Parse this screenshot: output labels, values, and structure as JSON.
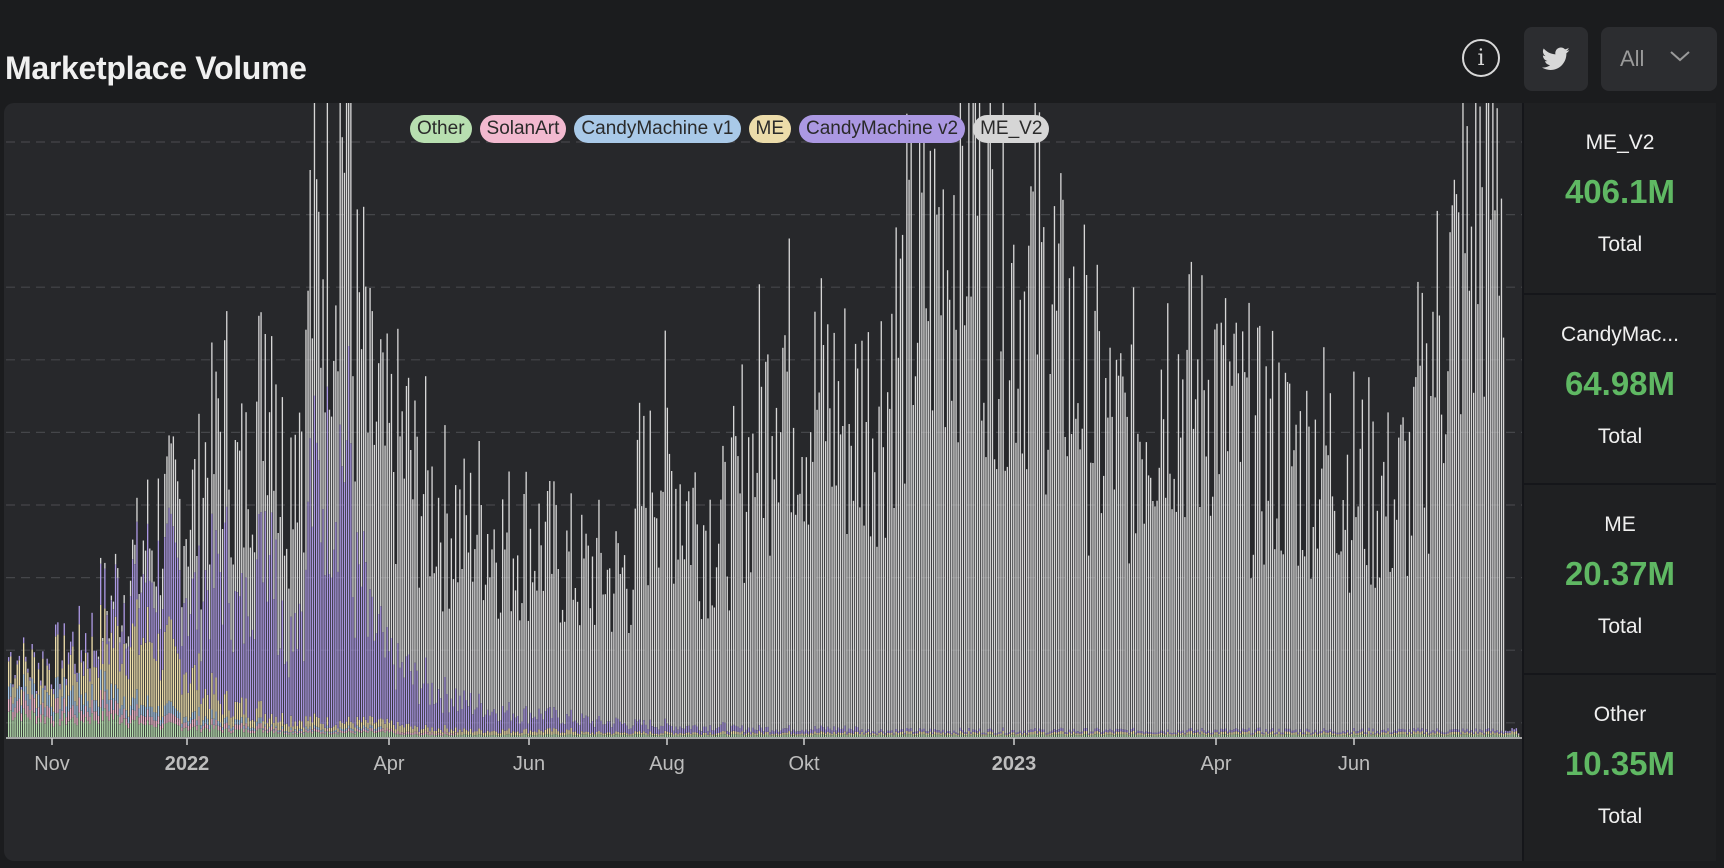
{
  "header": {
    "title": "Marketplace Volume",
    "info_icon": "info-circle-icon",
    "twitter_icon": "twitter-bird-icon",
    "filter_value": "All",
    "filter_icon": "chevron-down-icon"
  },
  "stats": [
    {
      "name": "ME_V2",
      "value": "406.1M",
      "caption": "Total"
    },
    {
      "name": "CandyMac...",
      "value": "64.98M",
      "caption": "Total"
    },
    {
      "name": "ME",
      "value": "20.37M",
      "caption": "Total"
    },
    {
      "name": "Other",
      "value": "10.35M",
      "caption": "Total"
    }
  ],
  "colors": {
    "value_green": "#5fb863",
    "panel_bg": "#27282b",
    "page_bg": "#1b1c1e"
  },
  "chart_data": {
    "type": "bar",
    "stacked": true,
    "title": "Marketplace Volume",
    "legend_position": "top-center",
    "grid": true,
    "legend": [
      {
        "name": "Other",
        "color": "#b8dfb0"
      },
      {
        "name": "SolanArt",
        "color": "#f2b9cf"
      },
      {
        "name": "CandyMachine v1",
        "color": "#a9c9e8"
      },
      {
        "name": "ME",
        "color": "#ecdcaa"
      },
      {
        "name": "CandyMachine v2",
        "color": "#ab98e2"
      },
      {
        "name": "ME_V2",
        "color": "#d6d6d6"
      }
    ],
    "x_ticks": [
      {
        "label": "Nov",
        "bold": false
      },
      {
        "label": "2022",
        "bold": true
      },
      {
        "label": "Apr",
        "bold": false
      },
      {
        "label": "Jun",
        "bold": false
      },
      {
        "label": "Aug",
        "bold": false
      },
      {
        "label": "Okt",
        "bold": false
      },
      {
        "label": "2023",
        "bold": true
      },
      {
        "label": "Apr",
        "bold": false
      },
      {
        "label": "Jun",
        "bold": false
      }
    ],
    "tick_positions": [
      48,
      183,
      385,
      525,
      663,
      800,
      1010,
      1212,
      1350
    ],
    "y_grid_count": 9,
    "weekly_envelope": [
      {
        "name": "Other",
        "values": [
          1.2,
          1.0,
          0.9,
          0.8,
          0.8,
          0.9,
          1.0,
          0.9,
          0.7,
          0.6,
          0.5,
          0.5,
          0.4,
          0.4,
          0.3,
          0.3,
          0.3,
          0.3,
          0.2,
          0.2,
          0.2,
          0.2,
          0.2,
          0.2,
          0.2,
          0.2,
          0.1,
          0.1,
          0.1,
          0.1,
          0.1,
          0.1,
          0.1,
          0.1,
          0.1,
          0.1,
          0.1,
          0.1,
          0.1,
          0.1,
          0.1,
          0.1,
          0.1,
          0.1,
          0.1,
          0.1,
          0.1,
          0.1,
          0.1,
          0.1,
          0.1,
          0.1,
          0.1,
          0.1,
          0.1,
          0.1,
          0.1,
          0.1,
          0.1,
          0.1,
          0.1,
          0.1,
          0.1,
          0.1,
          0.1,
          0.1,
          0.1,
          0.1,
          0.1,
          0.1,
          0.1,
          0.1,
          0.1,
          0.1,
          0.1,
          0.1,
          0.1,
          0.1,
          0.1,
          0.1,
          0.1,
          0.1,
          0.1,
          0.1,
          0.1,
          0.1,
          0.1,
          0.1,
          0.1,
          0.1,
          0.1,
          0.1,
          0.1,
          0.1,
          0.1,
          0.1,
          0.1,
          0.1,
          0.1,
          0.1,
          0.1
        ]
      },
      {
        "name": "SolanArt",
        "values": [
          0.6,
          0.6,
          0.5,
          0.5,
          0.5,
          0.5,
          0.6,
          0.5,
          0.4,
          0.4,
          0.3,
          0.3,
          0.3,
          0.2,
          0.2,
          0.2,
          0.2,
          0.2,
          0.1,
          0.1,
          0.1,
          0.1,
          0.1,
          0.1,
          0.1,
          0.1,
          0.1,
          0.1,
          0.1,
          0.1,
          0,
          0,
          0,
          0,
          0,
          0,
          0,
          0,
          0,
          0,
          0,
          0,
          0,
          0,
          0,
          0,
          0,
          0,
          0,
          0,
          0,
          0,
          0,
          0,
          0,
          0,
          0,
          0,
          0,
          0,
          0,
          0,
          0,
          0,
          0,
          0,
          0,
          0,
          0,
          0,
          0,
          0,
          0,
          0,
          0,
          0,
          0,
          0,
          0,
          0,
          0,
          0,
          0,
          0,
          0,
          0,
          0,
          0,
          0,
          0,
          0,
          0,
          0,
          0,
          0,
          0,
          0,
          0,
          0,
          0,
          0
        ]
      },
      {
        "name": "CandyMachine v1",
        "values": [
          0.6,
          0.6,
          0.6,
          0.7,
          0.8,
          0.6,
          0.7,
          0.6,
          0.5,
          0.5,
          0.4,
          0.3,
          0.3,
          0.3,
          0.2,
          0.2,
          0.2,
          0.1,
          0.1,
          0.1,
          0.1,
          0.1,
          0.1,
          0.1,
          0.1,
          0,
          0,
          0,
          0,
          0,
          0,
          0,
          0,
          0,
          0,
          0,
          0,
          0,
          0,
          0,
          0,
          0,
          0,
          0,
          0,
          0,
          0,
          0,
          0,
          0,
          0,
          0,
          0,
          0,
          0,
          0,
          0,
          0,
          0,
          0,
          0,
          0,
          0,
          0,
          0,
          0,
          0,
          0,
          0,
          0,
          0,
          0,
          0,
          0,
          0,
          0,
          0,
          0,
          0,
          0,
          0,
          0,
          0,
          0,
          0,
          0,
          0,
          0,
          0,
          0,
          0,
          0,
          0,
          0,
          0,
          0,
          0,
          0,
          0,
          0,
          0
        ]
      },
      {
        "name": "ME",
        "values": [
          1.2,
          1.1,
          1.2,
          1.4,
          1.6,
          1.8,
          2.2,
          2.6,
          3.0,
          3.2,
          2.8,
          2.4,
          1.8,
          1.2,
          0.9,
          0.7,
          0.6,
          0.5,
          0.5,
          0.4,
          0.4,
          0.3,
          0.3,
          0.3,
          0.3,
          0.3,
          0.3,
          0.2,
          0.2,
          0.2,
          0.2,
          0.2,
          0.2,
          0.2,
          0.2,
          0.2,
          0.2,
          0.2,
          0.1,
          0.1,
          0.1,
          0.1,
          0.1,
          0.1,
          0.1,
          0.1,
          0.1,
          0.1,
          0.1,
          0.1,
          0.1,
          0.1,
          0.1,
          0.1,
          0.1,
          0.1,
          0.1,
          0.1,
          0.1,
          0.1,
          0.1,
          0.1,
          0.1,
          0.1,
          0.1,
          0.1,
          0.1,
          0.1,
          0.1,
          0.1,
          0.1,
          0.1,
          0.1,
          0.1,
          0.1,
          0.1,
          0.1,
          0.1,
          0.1,
          0.1,
          0.1,
          0.1,
          0.1,
          0.1,
          0.1,
          0.1,
          0.1,
          0.1,
          0.1,
          0.1,
          0.1,
          0.1,
          0.1,
          0.1,
          0.1,
          0.1,
          0.1,
          0.1,
          0.1,
          0.1,
          0.1
        ]
      },
      {
        "name": "CandyMachine v2",
        "values": [
          0.2,
          0.2,
          0.3,
          0.4,
          0.6,
          0.9,
          1.4,
          2.0,
          2.6,
          3.0,
          3.6,
          4.0,
          3.6,
          5.2,
          6.4,
          4.4,
          6.8,
          9.6,
          4.2,
          5.6,
          10.8,
          11.6,
          12.8,
          6.4,
          4.2,
          3.0,
          2.6,
          2.2,
          1.8,
          1.6,
          1.3,
          1.2,
          1.0,
          0.9,
          0.8,
          0.8,
          0.7,
          0.6,
          0.6,
          0.5,
          0.5,
          0.4,
          0.4,
          0.4,
          0.3,
          0.3,
          0.3,
          0.3,
          0.2,
          0.2,
          0.2,
          0.2,
          0.2,
          0.2,
          0.2,
          0.2,
          0.2,
          0.1,
          0.1,
          0.1,
          0.1,
          0.1,
          0.1,
          0.1,
          0.1,
          0.1,
          0.1,
          0.1,
          0.1,
          0.1,
          0.1,
          0.1,
          0.1,
          0.1,
          0.1,
          0.1,
          0.1,
          0.1,
          0.1,
          0.1,
          0.1,
          0.1,
          0.1,
          0.1,
          0.1,
          0.1,
          0.1,
          0.1,
          0.1,
          0.1,
          0.1,
          0.1,
          0.1,
          0.1,
          0.1,
          0.1,
          0.1,
          0.1,
          0.1,
          0.1,
          0.1
        ]
      },
      {
        "name": "ME_V2",
        "values": [
          0,
          0,
          0,
          0,
          0,
          0,
          0.2,
          0.4,
          0.8,
          1.6,
          2.4,
          3.2,
          4.4,
          5.6,
          6.8,
          6.0,
          7.2,
          8.4,
          7.6,
          9.2,
          10.4,
          12.4,
          16.4,
          11.2,
          10.0,
          9.6,
          10.4,
          9.2,
          8.8,
          8.4,
          8.0,
          8.8,
          8.4,
          8.0,
          8.4,
          8.0,
          7.6,
          7.2,
          6.8,
          7.2,
          6.8,
          7.2,
          10.8,
          12.8,
          11.6,
          10.4,
          9.6,
          9.2,
          10.4,
          12.4,
          14.8,
          18.0,
          16.4,
          15.2,
          15.6,
          14.8,
          14.4,
          15.2,
          16.0,
          18.8,
          20.4,
          21.6,
          22.8,
          24.8,
          26.8,
          23.2,
          22.0,
          20.8,
          21.6,
          20.0,
          18.4,
          17.2,
          15.2,
          14.0,
          13.6,
          14.4,
          15.6,
          17.2,
          16.4,
          15.6,
          16.8,
          15.2,
          14.0,
          13.2,
          13.6,
          12.8,
          12.4,
          13.2,
          12.8,
          12.0,
          11.6,
          11.2,
          10.8,
          11.6,
          14.8,
          18.4,
          20.8,
          22.4,
          24.8,
          26.4
        ]
      }
    ],
    "value_unit": "relative weekly height (y-axis has no printed scale)",
    "y_max": 28
  }
}
